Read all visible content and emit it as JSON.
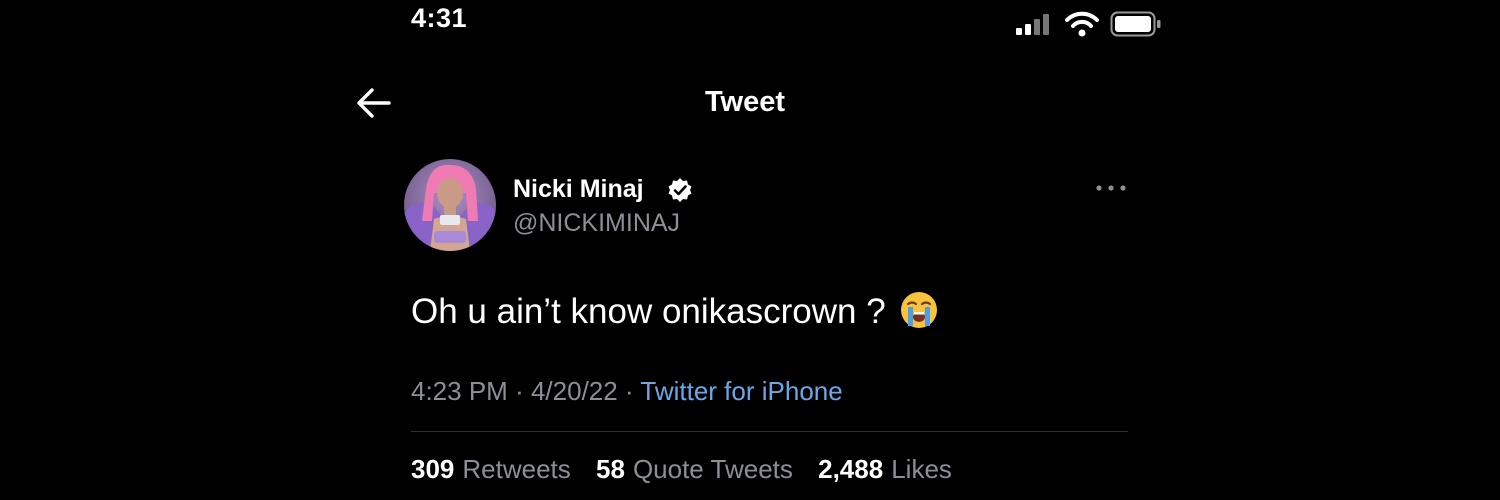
{
  "status_bar": {
    "time": "4:31"
  },
  "header": {
    "title": "Tweet"
  },
  "tweet": {
    "author": {
      "name": "Nicki Minaj",
      "handle": "@NICKIMINAJ"
    },
    "text": "Oh u ain’t know onikascrown ?",
    "emoji": "loudly-crying-face",
    "time": "4:23 PM",
    "date": "4/20/22",
    "separator": "·",
    "source": "Twitter for iPhone",
    "stats": {
      "retweets": {
        "count": "309",
        "label": "Retweets"
      },
      "quote_tweets": {
        "count": "58",
        "label": "Quote Tweets"
      },
      "likes": {
        "count": "2,488",
        "label": "Likes"
      }
    }
  },
  "colors": {
    "background": "#000000",
    "text_primary": "#ffffff",
    "text_secondary": "#8b9096",
    "link": "#6ea6e6",
    "divider": "#2f3336",
    "avatar_accent": "#f07ab4"
  },
  "icons": [
    "back-arrow-icon",
    "verified-icon",
    "more-icon",
    "signal-icon",
    "wifi-icon",
    "battery-icon"
  ]
}
